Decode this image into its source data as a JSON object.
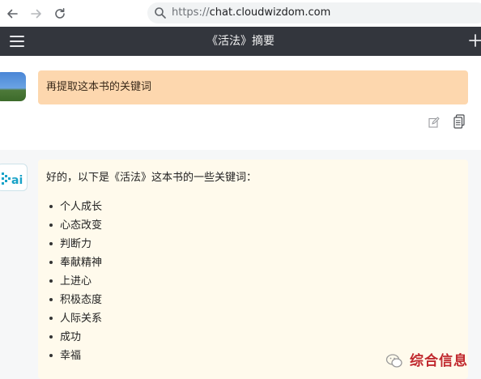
{
  "browser": {
    "url_protocol": "https://",
    "url_host": "chat.cloudwizdom.com",
    "icons": [
      "back-arrow-icon",
      "forward-arrow-icon",
      "reload-icon",
      "search-icon"
    ]
  },
  "header": {
    "title": "《活法》摘要",
    "icons": [
      "hamburger-menu-icon",
      "plus-icon"
    ]
  },
  "user_message": {
    "text": "再提取这本书的关键词",
    "icons": [
      "edit-icon",
      "copy-icon"
    ]
  },
  "ai_message": {
    "avatar_label": "ai",
    "intro": "好的，以下是《活法》这本书的一些关键词：",
    "keywords": [
      "个人成长",
      "心态改变",
      "判断力",
      "奉献精神",
      "上进心",
      "积极态度",
      "人际关系",
      "成功",
      "幸福"
    ]
  },
  "watermark": {
    "text": "综合信息"
  },
  "colors": {
    "header_bg": "#33363d",
    "user_bubble": "#fdd7ae",
    "ai_bubble": "#fffaec",
    "ai_accent": "#1aa3c8",
    "watermark_red": "#c0282d"
  }
}
